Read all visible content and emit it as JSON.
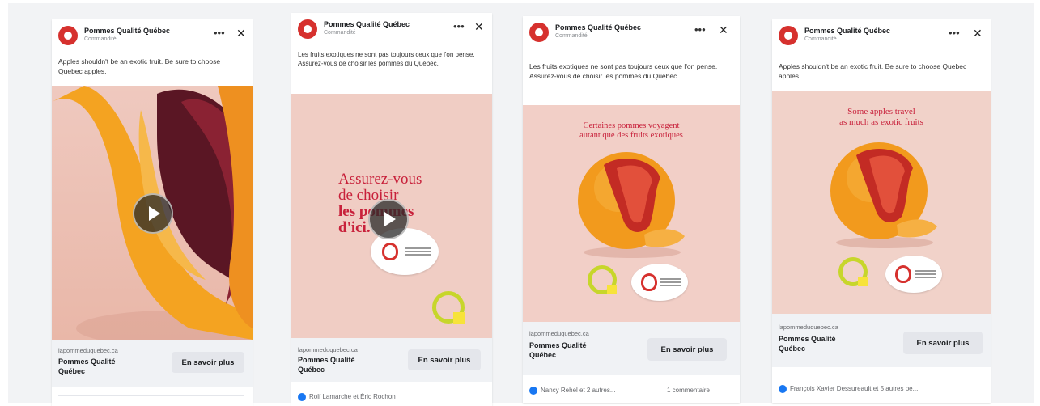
{
  "ads": [
    {
      "page_name": "Pommes Qualité Québec",
      "sponsored": "Commandité",
      "text": "Apples shouldn't be an exotic fruit. Be sure to choose Quebec apples.",
      "domain": "lapommeduquebec.ca",
      "link_title": "Pommes Qualité Québec",
      "cta": "En savoir plus",
      "media_type": "video"
    },
    {
      "page_name": "Pommes Qualité Québec",
      "sponsored": "Commandité",
      "text": "Les fruits exotiques ne sont pas toujours ceux que l'on pense. Assurez-vous de choisir les pommes du Québec.",
      "headline_lines": [
        "Assurez-vous",
        "de choisir",
        "les pommes",
        "d'ici."
      ],
      "domain": "lapommeduquebec.ca",
      "link_title": "Pommes Qualité Québec",
      "cta": "En savoir plus",
      "reactions": "Rolf Lamarche et Éric Rochon",
      "media_type": "video"
    },
    {
      "page_name": "Pommes Qualité Québec",
      "sponsored": "Commandité",
      "text": "Les fruits exotiques ne sont pas toujours ceux que l'on pense. Assurez-vous de choisir les pommes du Québec.",
      "headline_lines": [
        "Certaines pommes voyagent",
        "autant que des fruits exotiques"
      ],
      "domain": "lapommeduquebec.ca",
      "link_title": "Pommes Qualité Québec",
      "cta": "En savoir plus",
      "reactions": "Nancy Rehel et 2 autres...",
      "comments": "1 commentaire",
      "media_type": "image"
    },
    {
      "page_name": "Pommes Qualité Québec",
      "sponsored": "Commandité",
      "text": "Apples shouldn't be an exotic fruit. Be sure to choose Quebec apples.",
      "headline_lines": [
        "Some apples travel",
        "as much as exotic fruits"
      ],
      "domain": "lapommeduquebec.ca",
      "link_title": "Pommes Qualité Québec",
      "cta": "En savoir plus",
      "reactions": "François Xavier Dessureault et 5 autres pe...",
      "media_type": "image"
    }
  ],
  "colors": {
    "brand_red": "#d6312e",
    "headline_red": "#c8213b",
    "media_pink": "#f0cdc4",
    "orange": "#f39a1e",
    "badge_green": "#c7d62b",
    "badge_yellow": "#f7e33a",
    "footer_grey": "#f0f2f5",
    "reaction_blue": "#1877f2"
  },
  "icons": [
    "avatar-logo",
    "more-icon",
    "close-icon",
    "play-icon",
    "like-icon"
  ]
}
